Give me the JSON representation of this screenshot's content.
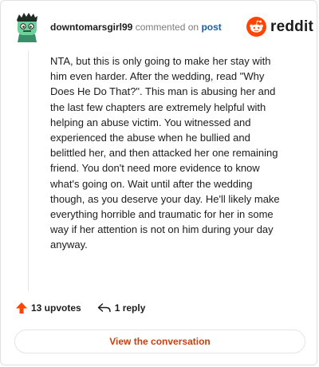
{
  "header": {
    "username": "downtomarsgirl99",
    "verb": "commented on",
    "post_link": "post"
  },
  "logo": {
    "wordmark": "reddit",
    "icon": "reddit-snoo-icon",
    "accent": "#ff4500"
  },
  "comment": {
    "lines": [
      "NTA, but this is only going to make her stay with",
      "him even harder. After the wedding, read \"Why",
      "Does He Do That?\". This man is abusing her and",
      "the last few chapters are extremely helpful with",
      "helping an abuse victim. You witnessed and",
      "experienced the abuse when he bullied and",
      "belittled her, and then attacked her one remaining",
      "friend. You don't need more evidence to know",
      "what's going on. Wait until after the wedding",
      "though, as you deserve your day. He'll likely make",
      "everything horrible and traumatic for her in some",
      "way if her attention is not on him during your day",
      "anyway."
    ]
  },
  "footer": {
    "upvotes": "13 upvotes",
    "upvote_icon": "upvote-arrow-icon",
    "replies": "1 reply",
    "reply_icon": "reply-arrow-icon"
  },
  "cta": {
    "label": "View the conversation",
    "color": "#c8410f"
  },
  "avatar": {
    "icon": "zombie-avatar-icon",
    "color": "#5fbf8a"
  }
}
